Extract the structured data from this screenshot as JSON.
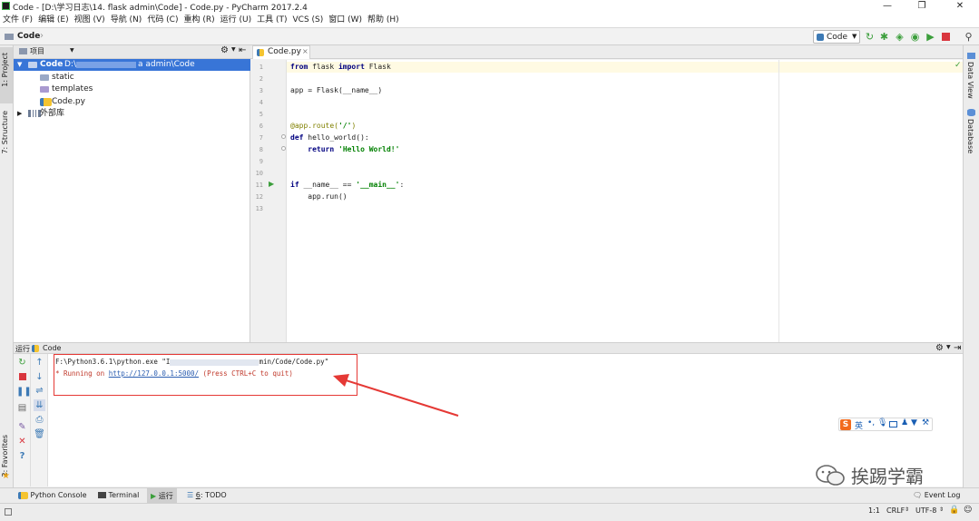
{
  "window": {
    "title": "Code - [D:\\学习日志\\14. flask admin\\Code] - Code.py - PyCharm 2017.2.4",
    "minimize": "—",
    "restore": "❐",
    "close": "✕"
  },
  "menu": [
    "文件 (F)",
    "编辑 (E)",
    "视图 (V)",
    "导航 (N)",
    "代码 (C)",
    "重构 (R)",
    "运行 (U)",
    "工具 (T)",
    "VCS (S)",
    "窗口 (W)",
    "帮助 (H)"
  ],
  "navbar": {
    "breadcrumb": "Code",
    "run_config": "Code"
  },
  "side_tabs": {
    "project": "1: Project",
    "structure": "7: Structure",
    "favorites": "2: Favorites",
    "data_view": "Data View",
    "database": "Database"
  },
  "project": {
    "header": "项目",
    "tree": [
      {
        "label": "Code",
        "path": "D:\\",
        "path_tail": "a admin\\Code"
      },
      {
        "label": "static"
      },
      {
        "label": "templates"
      },
      {
        "label": "Code.py"
      },
      {
        "label": "外部库"
      }
    ]
  },
  "editor": {
    "tab": "Code.py",
    "line_numbers": [
      "1",
      "2",
      "3",
      "4",
      "5",
      "6",
      "7",
      "8",
      "9",
      "10",
      "11",
      "12",
      "13"
    ]
  },
  "run": {
    "header_label": "运行",
    "config": "Code",
    "console_line1_a": "F:\\Python3.6.1\\python.exe \"I",
    "console_line1_b": "min/Code/Code.py\"",
    "console_line2_a": " * Running on ",
    "console_link": "http://127.0.0.1:5000/",
    "console_line2_b": " (Press CTRL+C to quit)"
  },
  "bottom_tabs": {
    "python_console": "Python Console",
    "terminal": "Terminal",
    "run": "运行",
    "todo_num": "6",
    "todo": "TODO",
    "event_log": "Event Log"
  },
  "status": {
    "position": "1:1",
    "line_sep": "CRLF",
    "encoding": "UTF-8"
  },
  "ime": {
    "logo": "S",
    "lang": "英"
  },
  "watermark": "挨踢学霸",
  "colors": {
    "selection": "#3875d7",
    "annotation": "#e53935",
    "run_green": "#3b9e3b",
    "stop_red": "#d9363e"
  }
}
